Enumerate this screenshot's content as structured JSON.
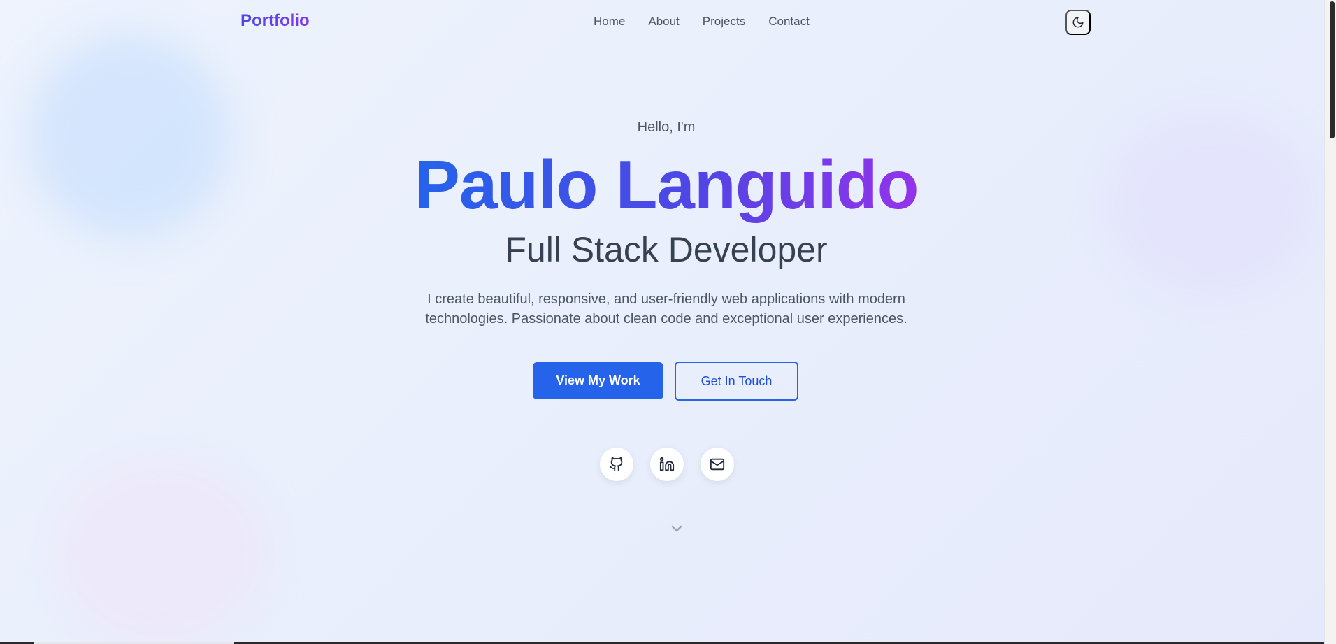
{
  "nav": {
    "brand": "Portfolio",
    "links": [
      {
        "label": "Home"
      },
      {
        "label": "About"
      },
      {
        "label": "Projects"
      },
      {
        "label": "Contact"
      }
    ],
    "theme_toggle_icon": "moon-icon"
  },
  "hero": {
    "greeting": "Hello, I'm",
    "name": "Paulo Languido",
    "role": "Full Stack Developer",
    "description": "I create beautiful, responsive, and user-friendly web applications with modern technologies. Passionate about clean code and exceptional user experiences.",
    "primary_button": "View My Work",
    "secondary_button": "Get In Touch",
    "socials": [
      {
        "icon": "github-icon"
      },
      {
        "icon": "linkedin-icon"
      },
      {
        "icon": "mail-icon"
      }
    ],
    "scroll_icon": "chevron-down-icon"
  },
  "colors": {
    "primary": "#2563eb",
    "gradient_start": "#2563eb",
    "gradient_end": "#9333ea",
    "text_muted": "#4b5563"
  }
}
